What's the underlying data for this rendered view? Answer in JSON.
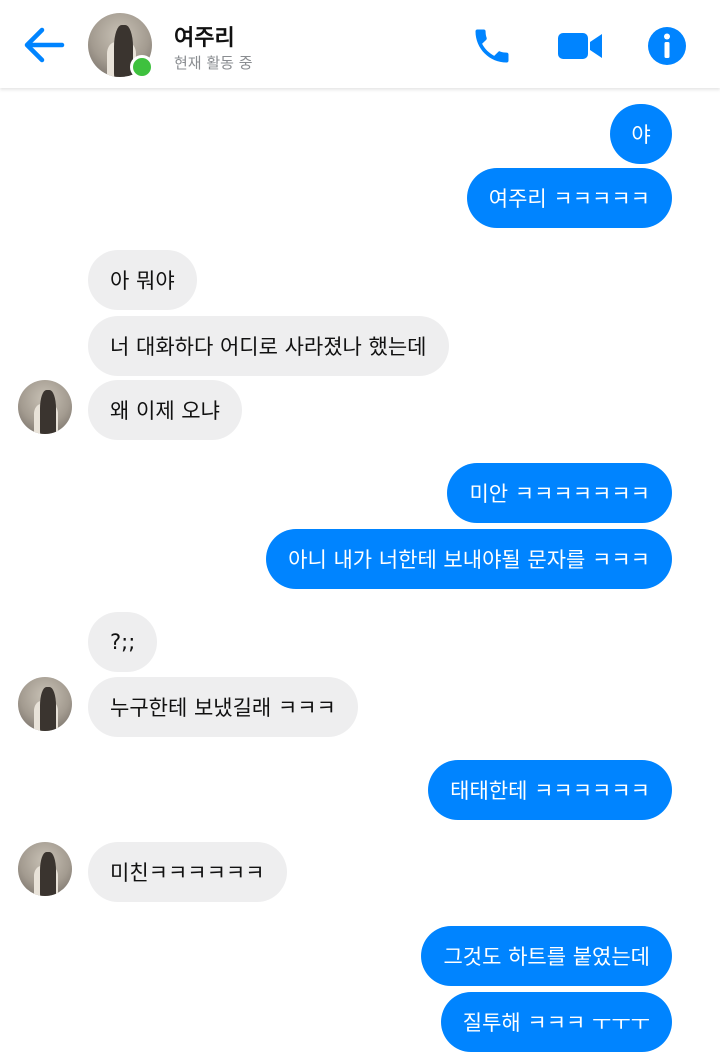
{
  "header": {
    "contact_name": "여주리",
    "status": "현재 활동 중",
    "accent_color": "#0084ff",
    "online_color": "#3ec13e",
    "icons": [
      "back-arrow-icon",
      "phone-icon",
      "video-camera-icon",
      "info-icon"
    ]
  },
  "messages": [
    {
      "sender": "me",
      "text": "야"
    },
    {
      "sender": "me",
      "text": "여주리 ㅋㅋㅋㅋㅋ"
    },
    {
      "sender": "them",
      "text": "아 뭐야"
    },
    {
      "sender": "them",
      "text": "너 대화하다 어디로 사라졌나 했는데"
    },
    {
      "sender": "them",
      "text": "왜 이제 오냐"
    },
    {
      "sender": "me",
      "text": "미안 ㅋㅋㅋㅋㅋㅋㅋ"
    },
    {
      "sender": "me",
      "text": "아니 내가 너한테 보내야될 문자를 ㅋㅋㅋ"
    },
    {
      "sender": "them",
      "text": "?;;"
    },
    {
      "sender": "them",
      "text": "누구한테 보냈길래 ㅋㅋㅋ"
    },
    {
      "sender": "me",
      "text": "태태한테 ㅋㅋㅋㅋㅋㅋ"
    },
    {
      "sender": "them",
      "text": "미친ㅋㅋㅋㅋㅋㅋ"
    },
    {
      "sender": "me",
      "text": "그것도 하트를 붙였는데"
    },
    {
      "sender": "me",
      "text": "질투해 ㅋㅋㅋ ㅜㅜㅜ"
    }
  ]
}
